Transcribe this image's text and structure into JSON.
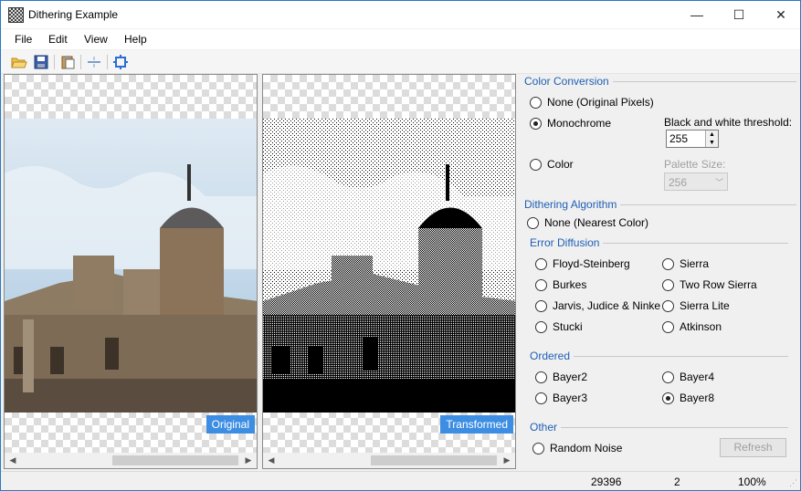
{
  "window": {
    "title": "Dithering Example",
    "minimize": "—",
    "maximize": "☐",
    "close": "✕"
  },
  "menu": [
    "File",
    "Edit",
    "View",
    "Help"
  ],
  "toolbar": {
    "icons": [
      "open-folder-icon",
      "save-disk-icon",
      "paste-icon",
      "split-view-icon",
      "fit-screen-icon"
    ]
  },
  "panels": {
    "left_label": "Original",
    "right_label": "Transformed"
  },
  "color_conversion": {
    "title": "Color Conversion",
    "none_label": "None (Original Pixels)",
    "monochrome_label": "Monochrome",
    "color_label": "Color",
    "threshold_label": "Black and white threshold:",
    "threshold_value": "255",
    "palette_label": "Palette Size:",
    "palette_value": "256",
    "selected": "monochrome"
  },
  "dithering": {
    "title": "Dithering Algorithm",
    "none_label": "None (Nearest Color)",
    "error_diffusion_title": "Error Diffusion",
    "error_diffusion": [
      "Floyd-Steinberg",
      "Burkes",
      "Jarvis, Judice & Ninke",
      "Stucki",
      "Sierra",
      "Two Row Sierra",
      "Sierra Lite",
      "Atkinson"
    ],
    "ordered_title": "Ordered",
    "ordered": [
      "Bayer2",
      "Bayer3",
      "Bayer4",
      "Bayer8"
    ],
    "other_title": "Other",
    "random_noise_label": "Random Noise",
    "refresh_label": "Refresh",
    "selected": "Bayer8"
  },
  "status": {
    "colors": "29396",
    "value2": "2",
    "zoom": "100%"
  },
  "colors": {
    "accent": "#3d8ee3",
    "group_title": "#1f5fb5",
    "sky": "#cfe0ee",
    "stone": "#8f7c63"
  }
}
